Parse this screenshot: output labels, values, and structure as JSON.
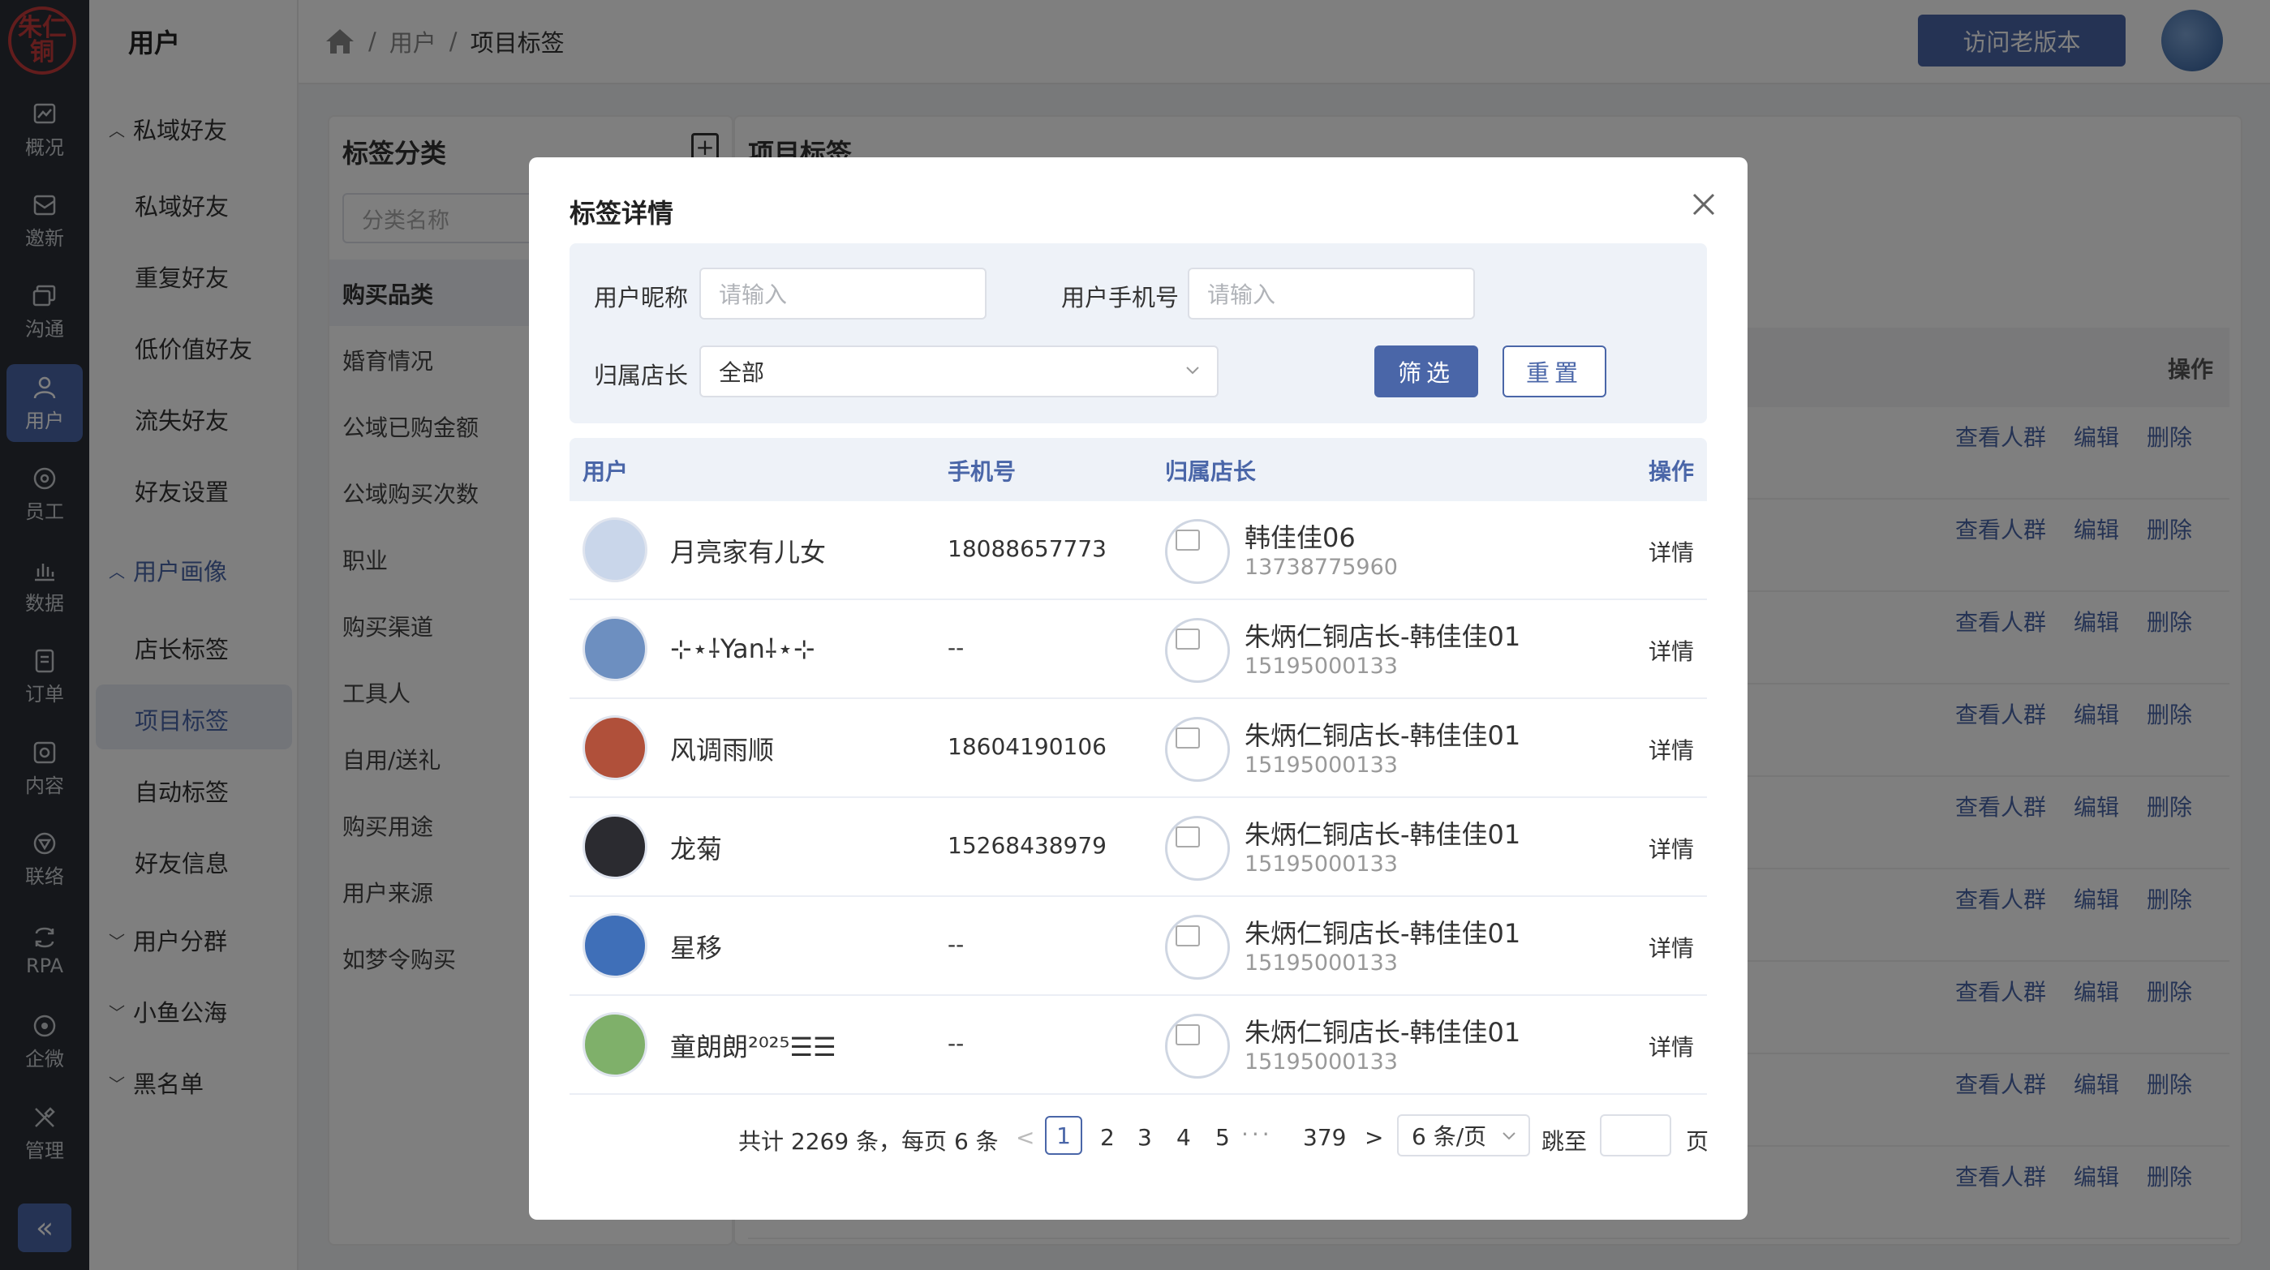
{
  "brand": {
    "logo_text": "朱炳仁铜"
  },
  "rail": {
    "items": [
      {
        "label": "概况",
        "icon": "chart-icon"
      },
      {
        "label": "邀新",
        "icon": "invite-icon"
      },
      {
        "label": "沟通",
        "icon": "chat-icon"
      },
      {
        "label": "用户",
        "icon": "user-icon"
      },
      {
        "label": "员工",
        "icon": "staff-icon"
      },
      {
        "label": "数据",
        "icon": "bar-chart-icon"
      },
      {
        "label": "订单",
        "icon": "order-icon"
      },
      {
        "label": "内容",
        "icon": "content-icon"
      },
      {
        "label": "联络",
        "icon": "contact-icon"
      },
      {
        "label": "RPA",
        "icon": "rpa-icon"
      },
      {
        "label": "企微",
        "icon": "wecom-icon"
      },
      {
        "label": "管理",
        "icon": "tools-icon"
      }
    ],
    "active_index": 3,
    "collapse_label": "«"
  },
  "subnav": {
    "title": "用户",
    "groups": [
      {
        "label": "私域好友",
        "expanded": true
      },
      {
        "label": "用户画像",
        "expanded": true
      },
      {
        "label": "用户分群",
        "expanded": false
      },
      {
        "label": "小鱼公海",
        "expanded": false
      },
      {
        "label": "黑名单",
        "expanded": false
      }
    ],
    "items_private": [
      "私域好友",
      "重复好友",
      "低价值好友",
      "流失好友",
      "好友设置"
    ],
    "items_portrait": [
      "店长标签",
      "项目标签",
      "自动标签",
      "好友信息"
    ],
    "active": "项目标签"
  },
  "header": {
    "breadcrumb": [
      "用户",
      "项目标签"
    ],
    "old_version_button": "访问老版本"
  },
  "background": {
    "left_title": "标签分类",
    "search_placeholder": "分类名称",
    "categories": [
      "购买品类",
      "婚育情况",
      "公域已购金额",
      "公域购买次数",
      "职业",
      "购买渠道",
      "工具人",
      "自用/送礼",
      "购买用途",
      "用户来源",
      "如梦令购买"
    ],
    "right_title": "项目标签",
    "op_header": "操作",
    "row_links": [
      "查看人群",
      "编辑",
      "删除"
    ]
  },
  "modal": {
    "title": "标签详情",
    "filters": {
      "nickname_label": "用户昵称",
      "nickname_placeholder": "请输入",
      "phone_label": "用户手机号",
      "phone_placeholder": "请输入",
      "owner_label": "归属店长",
      "owner_value": "全部",
      "filter_button": "筛选",
      "reset_button": "重置"
    },
    "columns": [
      "用户",
      "手机号",
      "归属店长",
      "操作"
    ],
    "rows": [
      {
        "nickname": "月亮家有儿女",
        "phone": "18088657773",
        "owner": "韩佳佳06",
        "owner_phone": "13738775960",
        "action": "详情",
        "avatar": "#c9d6ea"
      },
      {
        "nickname": "⊹⋆⸸Yan⸸⋆⊹",
        "phone": "--",
        "owner": "朱炳仁铜店长-韩佳佳01",
        "owner_phone": "15195000133",
        "action": "详情",
        "avatar": "#6d8fc0"
      },
      {
        "nickname": "风调雨顺",
        "phone": "18604190106",
        "owner": "朱炳仁铜店长-韩佳佳01",
        "owner_phone": "15195000133",
        "action": "详情",
        "avatar": "#b0503a"
      },
      {
        "nickname": "龙菊",
        "phone": "15268438979",
        "owner": "朱炳仁铜店长-韩佳佳01",
        "owner_phone": "15195000133",
        "action": "详情",
        "avatar": "#2b2b30"
      },
      {
        "nickname": "星移",
        "phone": "--",
        "owner": "朱炳仁铜店长-韩佳佳01",
        "owner_phone": "15195000133",
        "action": "详情",
        "avatar": "#3f6fb8"
      },
      {
        "nickname": "童朗朗²⁰²⁵☰☰",
        "phone": "--",
        "owner": "朱炳仁铜店长-韩佳佳01",
        "owner_phone": "15195000133",
        "action": "详情",
        "avatar": "#7fb06a"
      }
    ],
    "pagination": {
      "total_text": "共计 2269 条，每页 6 条",
      "prev": "<",
      "current": "1",
      "pages": [
        "2",
        "3",
        "4",
        "5"
      ],
      "dots": "···",
      "last": "379",
      "next": ">",
      "page_size": "6 条/页",
      "jump_label": "跳至",
      "page_suffix": "页"
    }
  }
}
